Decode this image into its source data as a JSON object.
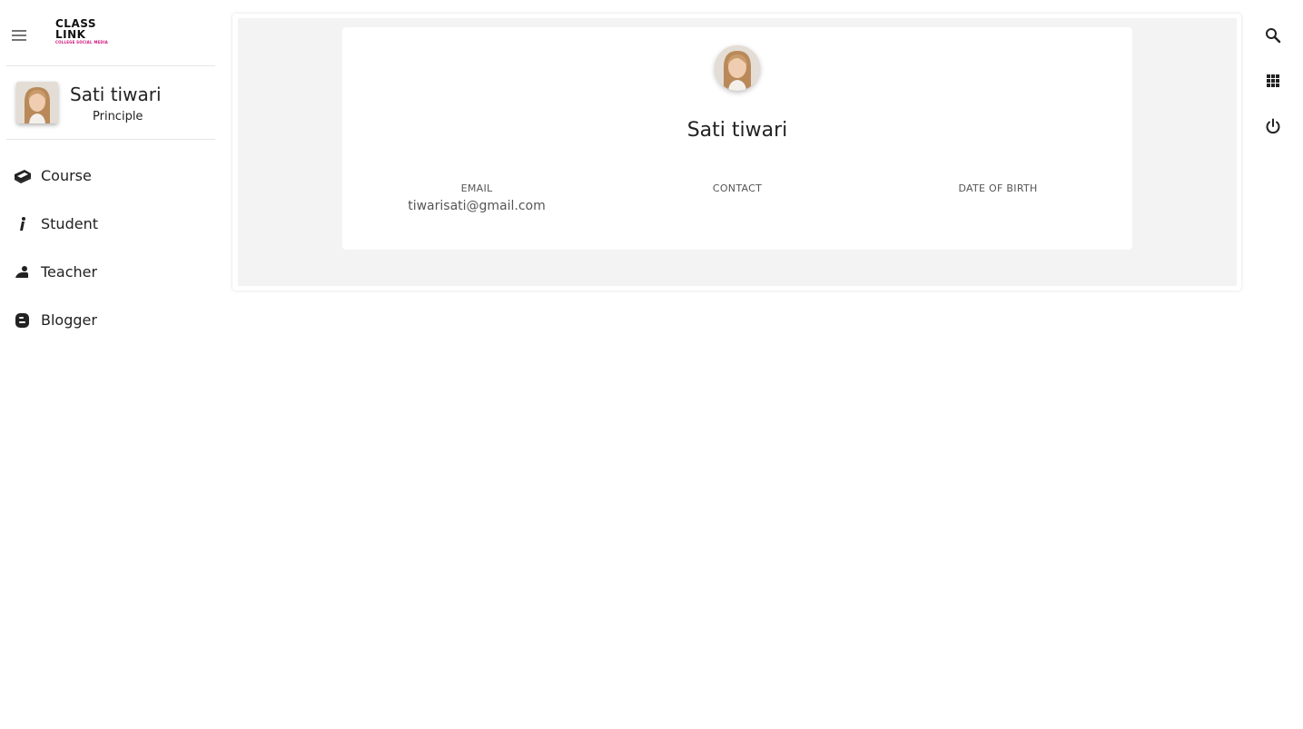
{
  "app": {
    "logo_line1": "CLASS",
    "logo_line2": "LINK",
    "logo_tagline": "COLLEGE SOCIAL MEDIA"
  },
  "sidebar": {
    "menu_icon": "hamburger-menu-icon",
    "profile": {
      "name": "Sati tiwari",
      "role": "Principle"
    },
    "items": [
      {
        "label": "Course",
        "icon": "book-icon"
      },
      {
        "label": "Student",
        "icon": "student-icon"
      },
      {
        "label": "Teacher",
        "icon": "teacher-icon"
      },
      {
        "label": "Blogger",
        "icon": "blogger-icon"
      }
    ]
  },
  "profile_card": {
    "name": "Sati tiwari",
    "fields": [
      {
        "label": "EMAIL",
        "value": "tiwarisati@gmail.com"
      },
      {
        "label": "CONTACT",
        "value": ""
      },
      {
        "label": "DATE OF BIRTH",
        "value": ""
      }
    ]
  },
  "rail": {
    "icons": [
      "search-icon",
      "apps-grid-icon",
      "power-icon"
    ]
  },
  "colors": {
    "logo_accent": "#d0107a",
    "content_bg": "#f3f3f3",
    "icon_gray": "#757575"
  }
}
